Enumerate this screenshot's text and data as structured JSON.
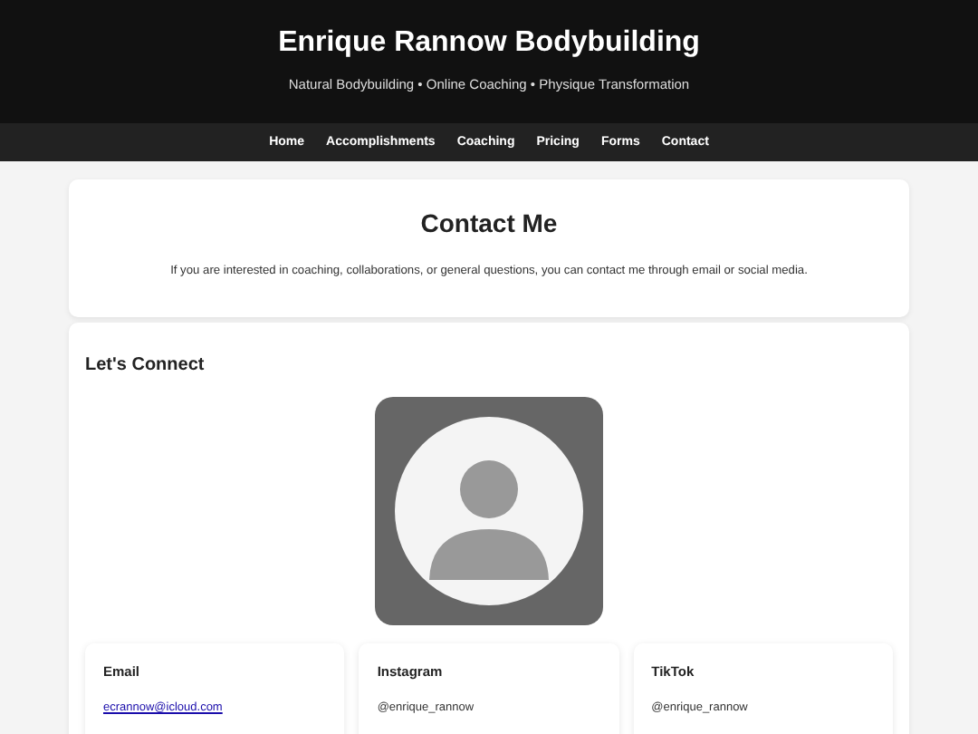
{
  "header": {
    "title": "Enrique Rannow Bodybuilding",
    "tagline": "Natural Bodybuilding • Online Coaching • Physique Transformation"
  },
  "nav": [
    {
      "label": "Home"
    },
    {
      "label": "Accomplishments"
    },
    {
      "label": "Coaching"
    },
    {
      "label": "Pricing"
    },
    {
      "label": "Forms"
    },
    {
      "label": "Contact"
    }
  ],
  "intro": {
    "title": "Contact Me",
    "text": "If you are interested in coaching, collaborations, or general questions, you can contact me through email or social media."
  },
  "connect": {
    "title": "Let's Connect",
    "avatar": {
      "kind": "placeholder"
    },
    "contacts": [
      {
        "label": "Email",
        "value": "ecrannow@icloud.com",
        "kind": "link"
      },
      {
        "label": "Instagram",
        "value": "@enrique_rannow",
        "kind": "text"
      },
      {
        "label": "TikTok",
        "value": "@enrique_rannow",
        "kind": "text"
      }
    ]
  }
}
